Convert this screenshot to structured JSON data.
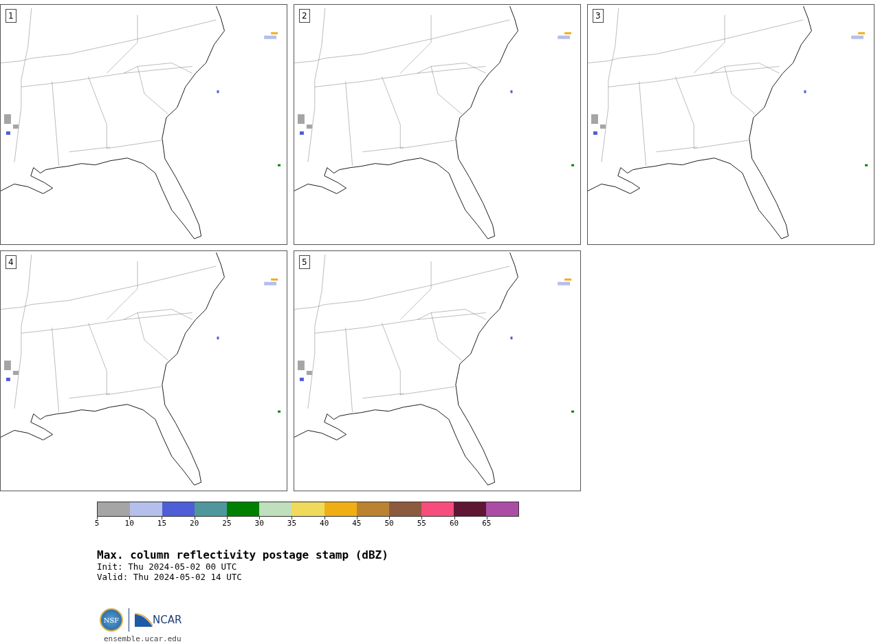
{
  "panels": [
    {
      "label": "1"
    },
    {
      "label": "2"
    },
    {
      "label": "3"
    },
    {
      "label": "4"
    },
    {
      "label": "5"
    }
  ],
  "colorbar": {
    "bins": [
      {
        "color": "#a5a5a5"
      },
      {
        "color": "#b4bfec"
      },
      {
        "color": "#4f5ed6"
      },
      {
        "color": "#4f979c"
      },
      {
        "color": "#008000"
      },
      {
        "color": "#bfdfbd"
      },
      {
        "color": "#f0da5c"
      },
      {
        "color": "#f0ae15"
      },
      {
        "color": "#bb8231"
      },
      {
        "color": "#8b5a3f"
      },
      {
        "color": "#f64d7c"
      },
      {
        "color": "#5e1633"
      },
      {
        "color": "#ac4da5"
      }
    ],
    "ticks": [
      "5",
      "10",
      "15",
      "20",
      "25",
      "30",
      "35",
      "40",
      "45",
      "50",
      "55",
      "60",
      "65"
    ]
  },
  "title": "Max. column reflectivity postage stamp (dBZ)",
  "init": " Init: Thu 2024-05-02 00 UTC",
  "valid": "Valid: Thu 2024-05-02 14 UTC",
  "logo": {
    "left": "NSF",
    "right": "NCAR"
  },
  "website": "ensemble.ucar.edu"
}
